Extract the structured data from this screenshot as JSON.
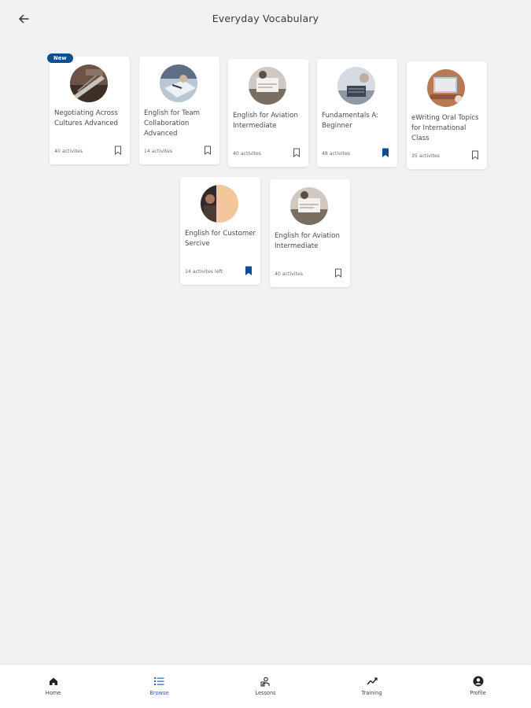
{
  "header": {
    "title": "Everyday Vocabulary"
  },
  "cards": [
    {
      "title": "Negotiating Across Cultures Advanced",
      "meta": "40 activites",
      "bookmarked": false,
      "badge": "New"
    },
    {
      "title": "English for Team Collaboration Advanced",
      "meta": "14 activites",
      "bookmarked": false
    },
    {
      "title": "English for Aviation Intermediate",
      "meta": "40 activites",
      "bookmarked": false
    },
    {
      "title": "Fundamentals A: Beginner",
      "meta": "48 activites",
      "bookmarked": true
    },
    {
      "title": "eWriting Oral Topics for International Class",
      "meta": "35 activites",
      "bookmarked": false
    },
    {
      "title": "English for Customer Sercive",
      "meta": "14 activites left",
      "bookmarked": true
    },
    {
      "title": "English for Aviation Intermediate",
      "meta": "40 activites",
      "bookmarked": false
    }
  ],
  "nav": {
    "items": [
      {
        "label": "Home",
        "icon": "home-icon"
      },
      {
        "label": "Browse",
        "icon": "list-icon",
        "active": true
      },
      {
        "label": "Lessons",
        "icon": "lessons-icon"
      },
      {
        "label": "Training",
        "icon": "trend-icon"
      },
      {
        "label": "Profile",
        "icon": "profile-icon"
      }
    ]
  },
  "colors": {
    "accent": "#0f4c91",
    "background": "#f1f2f2",
    "nav_active": "#2b5ea8"
  }
}
